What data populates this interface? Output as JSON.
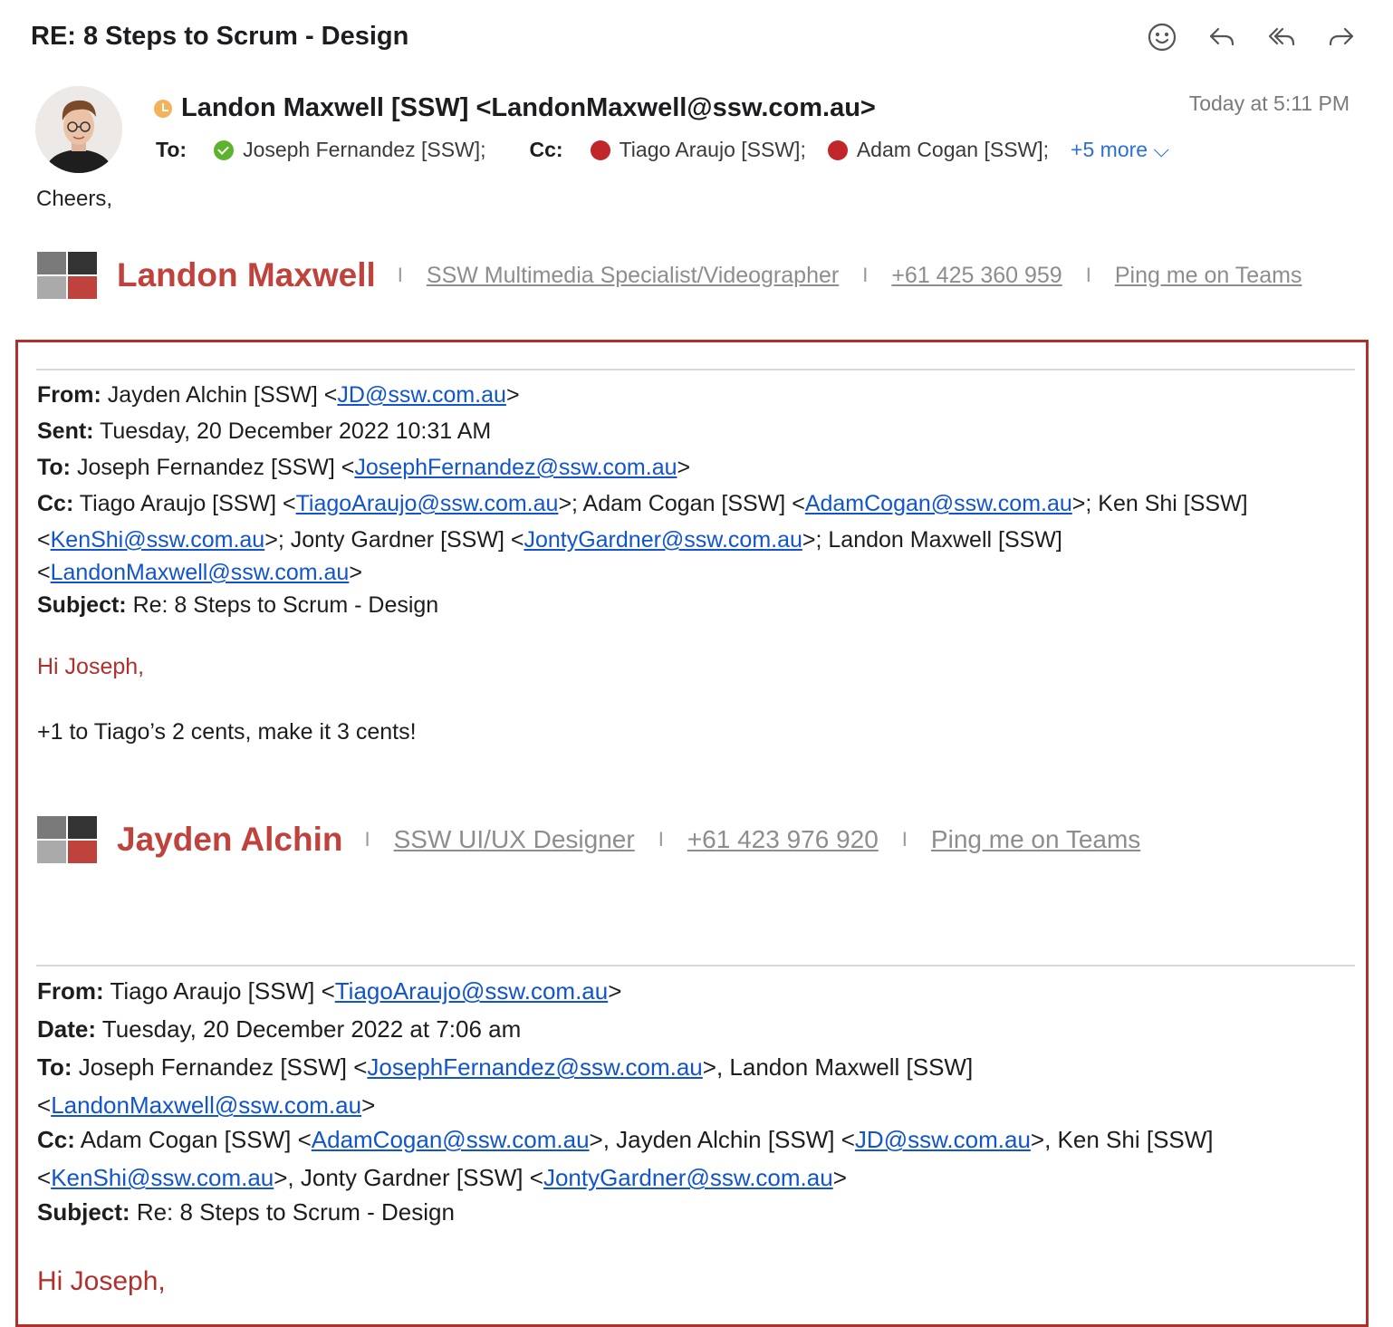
{
  "subject": "RE: 8 Steps to Scrum - Design",
  "toolbar": {
    "icons": [
      "emoji-reaction-icon",
      "reply-icon",
      "reply-all-icon",
      "forward-icon"
    ]
  },
  "message": {
    "sender": "Landon Maxwell [SSW] <LandonMaxwell@ssw.com.au>",
    "timestamp": "Today at 5:11 PM",
    "to_label": "To:",
    "to": "Joseph Fernandez [SSW];",
    "cc_label": "Cc:",
    "cc": [
      "Tiago Araujo [SSW];",
      "Adam Cogan [SSW];"
    ],
    "more": "+5 more ⌵"
  },
  "body": {
    "cheers": "Cheers,"
  },
  "signature1": {
    "name": "Landon Maxwell",
    "sep": "I",
    "title": "SSW Multimedia Specialist/Videographer",
    "phone": "+61 425 360 959",
    "teams": "Ping me on Teams"
  },
  "quote1": {
    "from_label": "From:",
    "from_name": "Jayden Alchin [SSW] <",
    "from_email": "JD@ssw.com.au",
    "gt": ">",
    "sent_label": "Sent:",
    "sent": "Tuesday, 20 December 2022 10:31 AM",
    "to_label": "To:",
    "to_name": "Joseph Fernandez [SSW] <",
    "to_email": "JosephFernandez@ssw.com.au",
    "cc_label": "Cc:",
    "cc_1_name": "Tiago Araujo [SSW] <",
    "cc_1_email": "TiagoAraujo@ssw.com.au",
    "cc_2_name": ">; Adam Cogan [SSW] <",
    "cc_2_email": "AdamCogan@ssw.com.au",
    "cc_3_name": ">; Ken Shi [SSW]",
    "lt": "<",
    "cc_3_email": "KenShi@ssw.com.au",
    "cc_4_name": ">; Jonty Gardner [SSW] <",
    "cc_4_email": "JontyGardner@ssw.com.au",
    "cc_5_name": ">; Landon Maxwell [SSW]",
    "cc_5_email": "LandonMaxwell@ssw.com.au",
    "subject_label": "Subject:",
    "subject": "Re: 8 Steps to Scrum - Design",
    "greeting": "Hi Joseph,",
    "text": "+1 to Tiago’s 2 cents, make it 3 cents!"
  },
  "signature2": {
    "name": "Jayden Alchin",
    "sep": "I",
    "title": "SSW UI/UX Designer",
    "phone": "+61 423 976 920",
    "teams": "Ping me on Teams"
  },
  "quote2": {
    "from_label": "From:",
    "from_name": "Tiago Araujo [SSW] <",
    "from_email": "TiagoAraujo@ssw.com.au",
    "gt": ">",
    "date_label": "Date:",
    "date": "Tuesday, 20 December 2022 at 7:06 am",
    "to_label": "To:",
    "to_1_name": "Joseph Fernandez [SSW] <",
    "to_1_email": "JosephFernandez@ssw.com.au",
    "to_2_name": ">, Landon Maxwell [SSW]",
    "lt": "<",
    "to_2_email": "LandonMaxwell@ssw.com.au",
    "cc_label": "Cc:",
    "cc_1_name": "Adam Cogan [SSW] <",
    "cc_1_email": "AdamCogan@ssw.com.au",
    "cc_2_name": ">, Jayden Alchin [SSW] <",
    "cc_2_email": "JD@ssw.com.au",
    "cc_3_name": ">, Ken Shi [SSW]",
    "cc_3_email": "KenShi@ssw.com.au",
    "cc_4_name": ">, Jonty Gardner [SSW] <",
    "cc_4_email": "JontyGardner@ssw.com.au",
    "subject_label": "Subject:",
    "subject": "Re: 8 Steps to Scrum - Design",
    "greeting": "Hi Joseph,"
  }
}
